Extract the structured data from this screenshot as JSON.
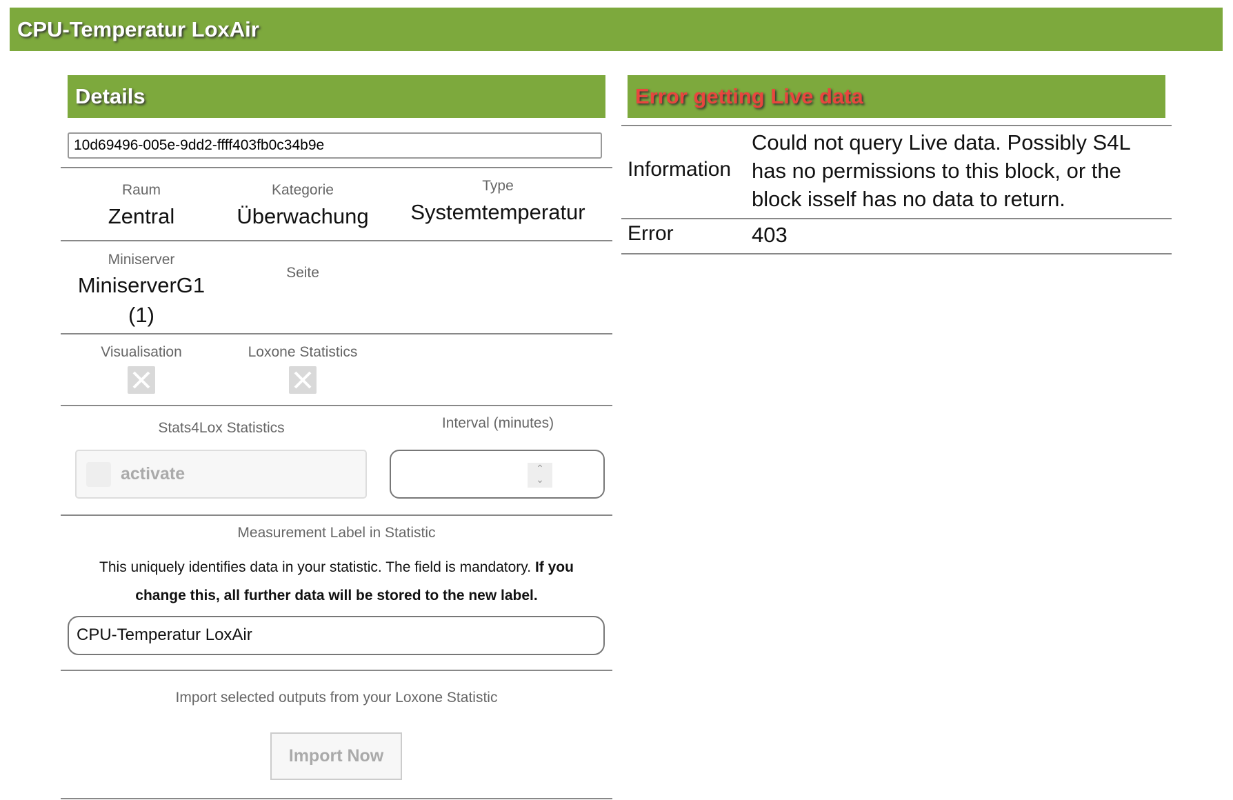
{
  "title": "CPU-Temperatur LoxAir",
  "details": {
    "header": "Details",
    "uuid": "10d69496-005e-9dd2-ffff403fb0c34b9e",
    "raum_label": "Raum",
    "raum": "Zentral",
    "kategorie_label": "Kategorie",
    "kategorie": "Überwachung",
    "type_label": "Type",
    "type": "Systemtemperatur",
    "miniserver_label": "Miniserver",
    "miniserver_line1": "MiniserverG1",
    "miniserver_line2": "(1)",
    "seite_label": "Seite",
    "visualisation_label": "Visualisation",
    "loxone_stats_label": "Loxone Statistics",
    "stats4lox_label": "Stats4Lox Statistics",
    "activate_label": "activate",
    "interval_label": "Interval (minutes)",
    "interval_value": "",
    "measurement_label": "Measurement Label in Statistic",
    "measurement_help": "This uniquely identifies data in your statistic. The field is mandatory.",
    "measurement_help_bold": "If you change this, all further data will be stored to the new label.",
    "measurement_value": "CPU-Temperatur LoxAir",
    "import_text": "Import selected outputs from your Loxone Statistic",
    "import_button": "Import Now"
  },
  "live": {
    "header": "Error getting Live data",
    "information_label": "Information",
    "information": "Could not query Live data. Possibly S4L has no permissions to this block, or the block isself has no data to return.",
    "error_label": "Error",
    "error": "403"
  },
  "colors": {
    "accent": "#7da93d",
    "error": "#e8463e"
  }
}
